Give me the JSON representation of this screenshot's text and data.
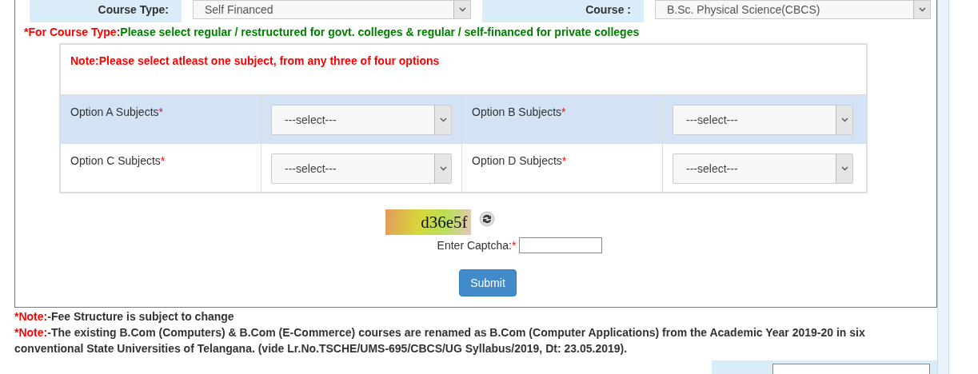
{
  "course_row": [
    {
      "label": "Course Type:",
      "value": "Self Financed"
    },
    {
      "label": "Course :",
      "value": "B.Sc. Physical Science(CBCS)"
    }
  ],
  "course_type_hint": {
    "prefix": "*For Course Type:",
    "text": "Please select regular / restructured for govt. colleges & regular / self-financed for private colleges"
  },
  "subjects": {
    "note": "Note:Please select atleast one subject, from any three of four options",
    "rows": [
      {
        "shaded": true,
        "options": [
          {
            "label": "Option A Subjects",
            "required": "*",
            "value": "---select---"
          },
          {
            "label": "Option B Subjects",
            "required": "*",
            "value": "---select---"
          }
        ]
      },
      {
        "shaded": false,
        "options": [
          {
            "label": "Option C Subjects",
            "required": "*",
            "value": "---select---"
          },
          {
            "label": "Option D Subjects",
            "required": "*",
            "value": "---select---"
          }
        ]
      }
    ]
  },
  "captcha": {
    "code": "d36e5f",
    "label": "Enter Captcha:",
    "required": "*"
  },
  "submit": "Submit",
  "notes": [
    {
      "prefix": "*Note:",
      "text": "-Fee Structure is subject to change"
    },
    {
      "prefix": "*Note:",
      "text": "-The existing B.Com (Computers) & B.Com (E-Commerce) courses are renamed as B.Com (Computer Applications) from the Academic Year 2019-20 in six conventional State Universities of Telangana. (vide Lr.No.TSCHE/UMS-695/CBCS/UG Syllabus/2019, Dt: 23.05.2019)."
    }
  ]
}
